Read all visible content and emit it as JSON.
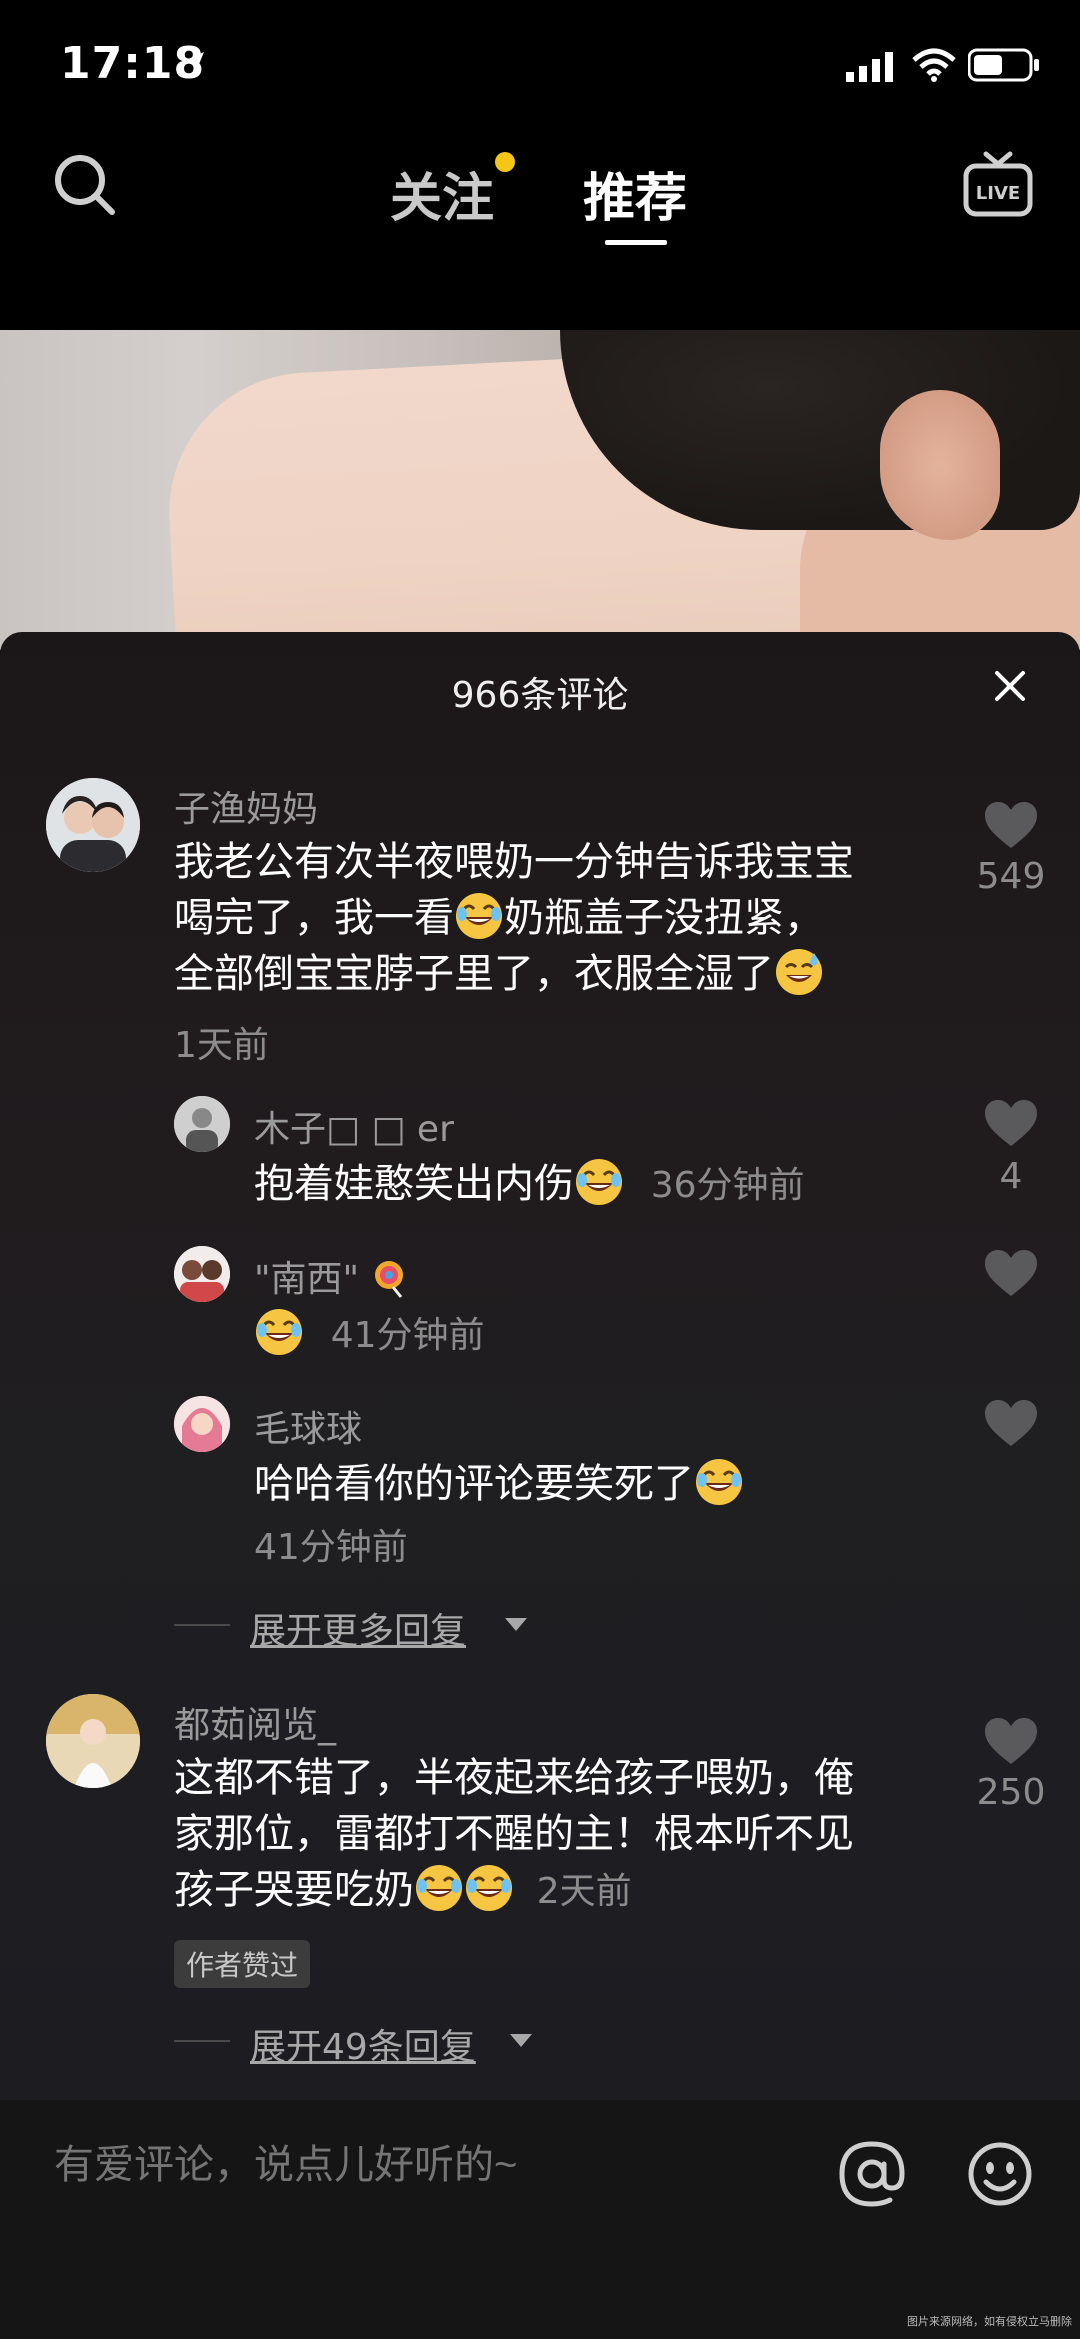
{
  "status": {
    "time": "17:18"
  },
  "nav": {
    "follow": "关注",
    "recommend": "推荐"
  },
  "sheet": {
    "title": "966条评论"
  },
  "comments": [
    {
      "user": "子渔妈妈",
      "lines": [
        "我老公有次半夜喂奶一分钟告诉我宝宝",
        "喝完了，我一看",
        "奶瓶盖子没扭紧，",
        "全部倒宝宝脖子里了，衣服全湿了"
      ],
      "time": "1天前",
      "likes": "549"
    },
    {
      "user": "都茹阅览_",
      "lines": [
        "这都不错了，半夜起来给孩子喂奶，俺",
        "家那位，雷都打不醒的主！根本听不见",
        "孩子哭要吃奶"
      ],
      "time": "2天前",
      "badge": "作者赞过",
      "likes": "250"
    }
  ],
  "replies": [
    {
      "user": "木子□ □ er",
      "text": "抱着娃憨笑出内伤",
      "time": "36分钟前",
      "likes": "4"
    },
    {
      "user": "\"南西\"",
      "time": "41分钟前"
    },
    {
      "user": "毛球球",
      "text": "哈哈看你的评论要笑死了",
      "time": "41分钟前"
    }
  ],
  "more_replies": "展开更多回复",
  "more_replies_2": "展开49条回复",
  "input": {
    "placeholder": "有爱评论，说点儿好听的~"
  },
  "watermark": "图片来源网络，如有侵权立马删除",
  "colors": {
    "accent_dot": "#f5c518",
    "sheet_bg": "#1f1c1f"
  }
}
